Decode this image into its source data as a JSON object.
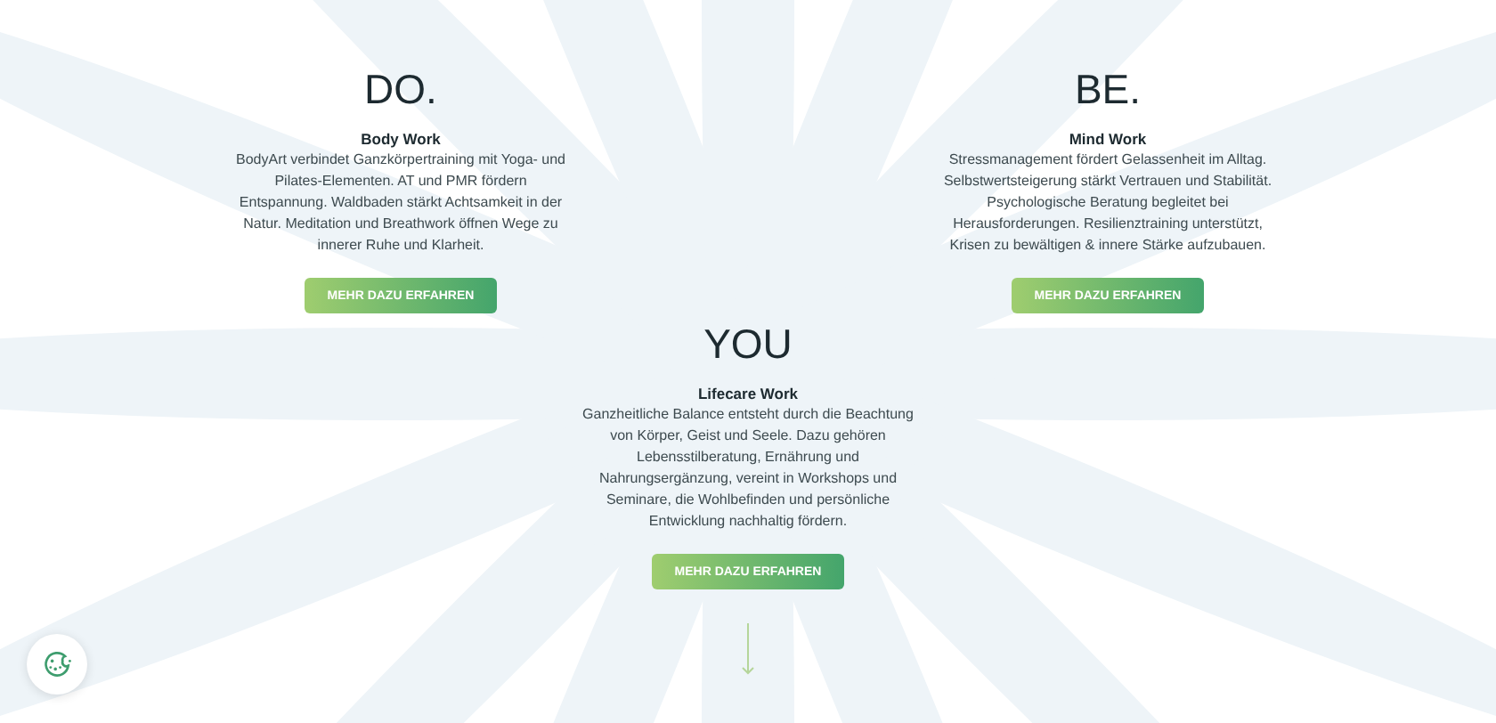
{
  "sections": [
    {
      "title": "DO.",
      "heading": "Body Work",
      "text": "BodyArt verbindet Ganzkörpertraining mit Yoga- und Pilates-Elementen. AT und PMR fördern Entspannung. Waldbaden stärkt Achtsamkeit in der Natur. Meditation und Breathwork öffnen Wege zu innerer Ruhe und Klarheit.",
      "button": "MEHR DAZU ERFAHREN"
    },
    {
      "title": "BE.",
      "heading": "Mind Work",
      "text": "Stressmanagement fördert Gelassenheit im Alltag. Selbstwertsteigerung stärkt Vertrauen und Stabilität. Psychologische Beratung begleitet bei Herausforderungen. Resilienztraining unterstützt, Krisen zu bewältigen & innere Stärke aufzubauen.",
      "button": "MEHR DAZU ERFAHREN"
    },
    {
      "title": "YOU",
      "heading": "Lifecare Work",
      "text": "Ganzheitliche Balance entsteht durch die Beachtung von Körper, Geist und Seele. Dazu gehören Lebensstilberatung, Ernährung und Nahrungsergänzung, vereint in Workshops und Seminare, die Wohlbefinden und persönliche Entwicklung nachhaltig fördern.",
      "button": "MEHR DAZU ERFAHREN"
    }
  ]
}
